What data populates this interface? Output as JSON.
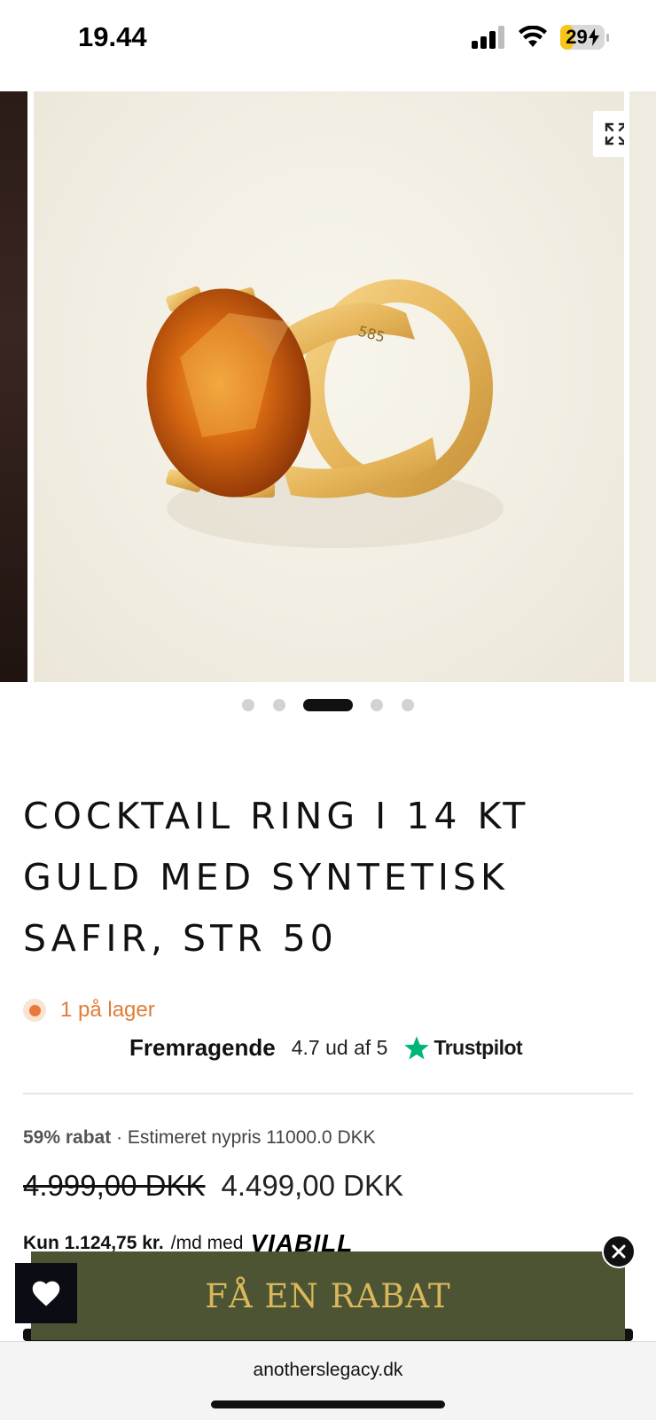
{
  "status_bar": {
    "time": "19.44",
    "battery": "29",
    "battery_level": 0.29,
    "icons": [
      "cellular-signal-icon",
      "wifi-icon",
      "battery-charging-icon"
    ]
  },
  "gallery": {
    "slide_count": 5,
    "active_index": 2,
    "image_alt": "Cocktail ring with orange stone",
    "expand_icon": "expand-icon"
  },
  "product": {
    "title": "COCKTAIL RING I 14 KT GULD MED SYNTETISK SAFIR, STR 50",
    "stock": "1 på lager",
    "trustpilot": {
      "rating_word": "Fremragende",
      "score": "4.7 ud af 5",
      "brand": "Trustpilot"
    },
    "discount_label": "59% rabat",
    "estimate": "· Estimeret nypris 11000.0 DKK",
    "price_old": "4.999,00 DKK",
    "price_new": "4.499,00 DKK",
    "installment_prefix": "Kun 1.124,75 kr.",
    "installment_suffix": "/md med",
    "installment_provider": "VIABILL"
  },
  "promo": {
    "label": "FÅ EN RABAT"
  },
  "browser": {
    "url": "anotherslegacy.dk"
  },
  "colors": {
    "accent_orange": "#e07c36",
    "promo_bg": "#4c5434",
    "promo_text": "#d9b75a",
    "trustpilot_green": "#00b67a"
  }
}
